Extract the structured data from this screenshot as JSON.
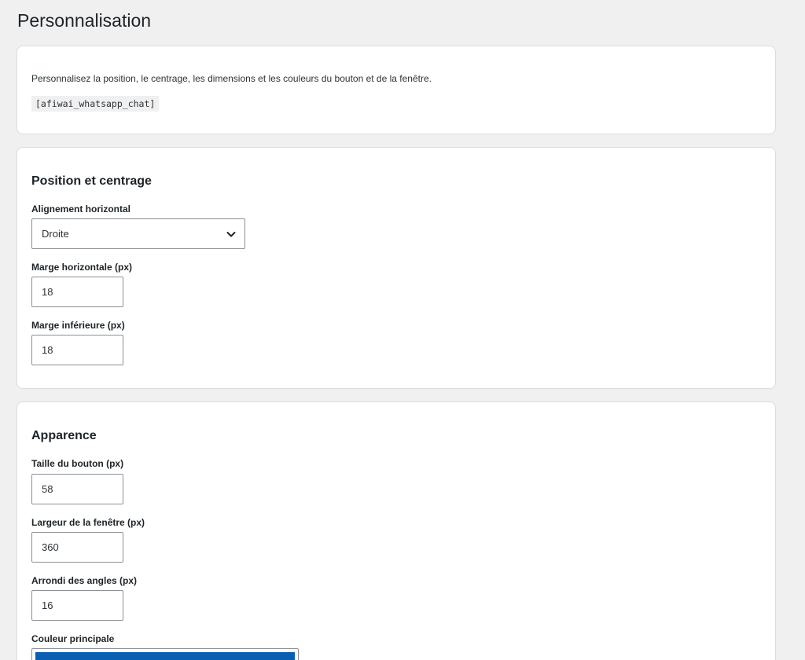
{
  "page": {
    "title": "Personnalisation"
  },
  "intro": {
    "description": "Personnalisez la position, le centrage, les dimensions et les couleurs du bouton et de la fenêtre.",
    "shortcode": "[afiwai_whatsapp_chat]"
  },
  "position_section": {
    "heading": "Position et centrage",
    "horizontal_alignment": {
      "label": "Alignement horizontal",
      "selected": "Droite"
    },
    "horizontal_margin": {
      "label": "Marge horizontale (px)",
      "value": "18"
    },
    "bottom_margin": {
      "label": "Marge inférieure (px)",
      "value": "18"
    }
  },
  "appearance_section": {
    "heading": "Apparence",
    "button_size": {
      "label": "Taille du bouton (px)",
      "value": "58"
    },
    "window_width": {
      "label": "Largeur de la fenêtre (px)",
      "value": "360"
    },
    "corner_radius": {
      "label": "Arrondi des angles (px)",
      "value": "16"
    },
    "primary_color": {
      "label": "Couleur principale",
      "value": "#0b5fb3"
    }
  },
  "icons": {
    "select_arrow": "chevron-down-icon"
  }
}
